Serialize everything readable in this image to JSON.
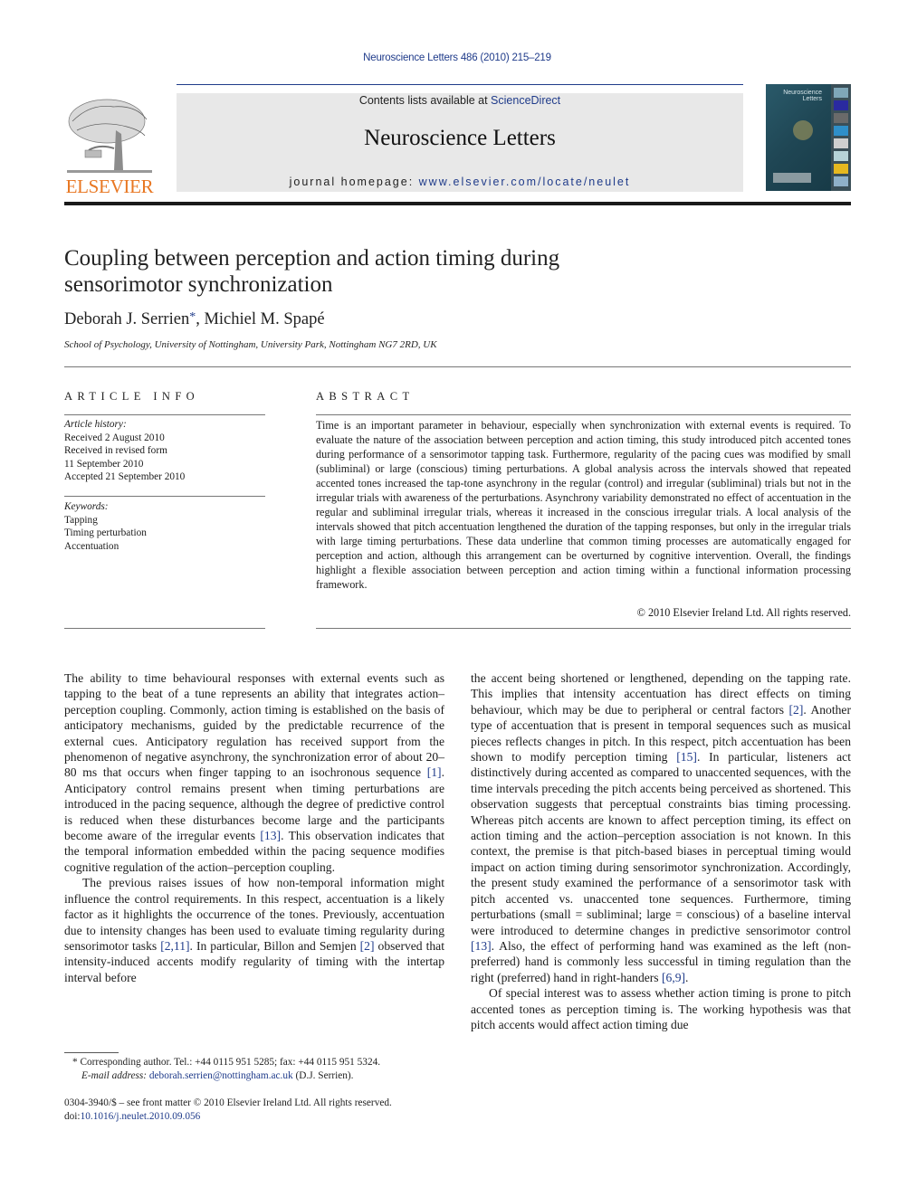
{
  "header": {
    "journal_ref": "Neuroscience Letters 486 (2010) 215–219",
    "contents_prefix": "Contents lists available at ",
    "contents_link": "ScienceDirect",
    "journal_name": "Neuroscience Letters",
    "homepage_prefix": "journal homepage: ",
    "homepage_link": "www.elsevier.com/locate/neulet",
    "publisher_logo_text": "ELSEVIER",
    "cover_title_line1": "Neuroscience",
    "cover_title_line2": "Letters",
    "colors": {
      "link": "#1f3b8a",
      "elsevier_orange": "#e87722",
      "masthead_bg": "#e8e8e8"
    }
  },
  "article": {
    "title_line1": "Coupling between perception and action timing during",
    "title_line2": "sensorimotor synchronization",
    "author1": "Deborah J. Serrien",
    "author1_mark": "*",
    "author_sep": ", ",
    "author2": "Michiel M. Spapé",
    "affiliation": "School of Psychology, University of Nottingham, University Park, Nottingham NG7 2RD, UK"
  },
  "article_info": {
    "heading": "ARTICLE INFO",
    "history_label": "Article history:",
    "history": [
      "Received 2 August 2010",
      "Received in revised form",
      "11 September 2010",
      "Accepted 21 September 2010"
    ],
    "keywords_label": "Keywords:",
    "keywords": [
      "Tapping",
      "Timing perturbation",
      "Accentuation"
    ]
  },
  "abstract": {
    "heading": "ABSTRACT",
    "text": "Time is an important parameter in behaviour, especially when synchronization with external events is required. To evaluate the nature of the association between perception and action timing, this study introduced pitch accented tones during performance of a sensorimotor tapping task. Furthermore, regularity of the pacing cues was modified by small (subliminal) or large (conscious) timing perturbations. A global analysis across the intervals showed that repeated accented tones increased the tap-tone asynchrony in the regular (control) and irregular (subliminal) trials but not in the irregular trials with awareness of the perturbations. Asynchrony variability demonstrated no effect of accentuation in the regular and subliminal irregular trials, whereas it increased in the conscious irregular trials. A local analysis of the intervals showed that pitch accentuation lengthened the duration of the tapping responses, but only in the irregular trials with large timing perturbations. These data underline that common timing processes are automatically engaged for perception and action, although this arrangement can be overturned by cognitive intervention. Overall, the findings highlight a flexible association between perception and action timing within a functional information processing framework.",
    "copyright": "© 2010 Elsevier Ireland Ltd. All rights reserved."
  },
  "body": {
    "p1_a": "The ability to time behavioural responses with external events such as tapping to the beat of a tune represents an ability that integrates action–perception coupling. Commonly, action timing is established on the basis of anticipatory mechanisms, guided by the predictable recurrence of the external cues. Anticipatory regulation has received support from the phenomenon of negative asynchrony, the synchronization error of about 20–80 ms that occurs when finger tapping to an isochronous sequence ",
    "p1_ref1": "[1]",
    "p1_b": ". Anticipatory control remains present when timing perturbations are introduced in the pacing sequence, although the degree of predictive control is reduced when these disturbances become large and the participants become aware of the irregular events ",
    "p1_ref2": "[13]",
    "p1_c": ". This observation indicates that the temporal information embedded within the pacing sequence modifies cognitive regulation of the action–perception coupling.",
    "p2_a": "The previous raises issues of how non-temporal information might influence the control requirements. In this respect, accentuation is a likely factor as it highlights the occurrence of the tones. Previously, accentuation due to intensity changes has been used to evaluate timing regularity during sensorimotor tasks ",
    "p2_ref1": "[2,11]",
    "p2_b": ". In particular, Billon and Semjen ",
    "p2_ref2": "[2]",
    "p2_c": " observed that intensity-induced accents modify regularity of timing with the intertap interval before the accent being shortened or lengthened, depending on the tapping rate. This implies that intensity accentuation has direct effects on timing behaviour, which may be due to peripheral or central factors ",
    "p2_ref3": "[2]",
    "p2_d": ". Another type of accentuation that is present in temporal sequences such as musical pieces reflects changes in pitch. In this respect, pitch accentuation has been shown to modify perception timing ",
    "p2_ref4": "[15]",
    "p2_e": ". In particular, listeners act distinctively during accented as compared to unaccented sequences, with the time intervals preceding the pitch accents being perceived as shortened. This observation suggests that perceptual constraints bias timing processing. Whereas pitch accents are known to affect perception timing, its effect on action timing and the action–perception association is not known. In this context, the premise is that pitch-based biases in perceptual timing would impact on action timing during sensorimotor synchronization. Accordingly, the present study examined the performance of a sensorimotor task with pitch accented vs. unaccented tone sequences. Furthermore, timing perturbations (small = subliminal; large = conscious) of a baseline interval were introduced to determine changes in predictive sensorimotor control ",
    "p2_ref5": "[13]",
    "p2_f": ". Also, the effect of performing hand was examined as the left (non-preferred) hand is commonly less successful in timing regulation than the right (preferred) hand in right-handers ",
    "p2_ref6": "[6,9]",
    "p2_g": ".",
    "p3": "Of special interest was to assess whether action timing is prone to pitch accented tones as perception timing is. The working hypothesis was that pitch accents would affect action timing due"
  },
  "footnote": {
    "mark": "*",
    "corresponding": " Corresponding author. Tel.: +44 0115 951 5285; fax: +44 0115 951 5324.",
    "email_label": "E-mail address:",
    "email": "deborah.serrien@nottingham.ac.uk",
    "email_suffix": " (D.J. Serrien)."
  },
  "front_matter": {
    "issn_line": "0304-3940/$ – see front matter © 2010 Elsevier Ireland Ltd. All rights reserved.",
    "doi_prefix": "doi:",
    "doi": "10.1016/j.neulet.2010.09.056"
  }
}
